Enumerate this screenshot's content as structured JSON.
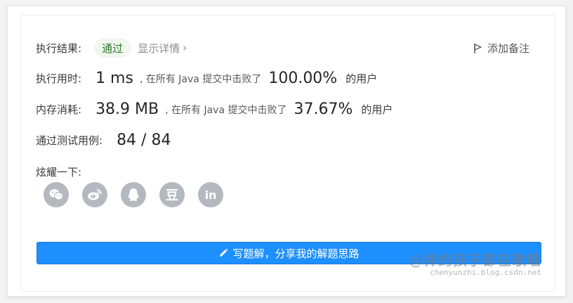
{
  "result": {
    "label": "执行结果:",
    "status": "通过",
    "detail_link": "显示详情",
    "note_button": "添加备注"
  },
  "runtime": {
    "label": "执行用时:",
    "value": "1 ms",
    "text": ", 在所有 Java 提交中击败了",
    "percent": "100.00%",
    "suffix": "的用户"
  },
  "memory": {
    "label": "内存消耗:",
    "value": "38.9 MB",
    "text": ", 在所有 Java 提交中击败了",
    "percent": "37.67%",
    "suffix": "的用户"
  },
  "tests": {
    "label": "通过测试用例:",
    "value": "84 / 84"
  },
  "share": {
    "label": "炫耀一下:",
    "icons": [
      "wechat-icon",
      "weibo-icon",
      "qq-icon",
      "douban-icon",
      "linkedin-icon"
    ],
    "douban_glyph": "豆",
    "linkedin_glyph": "in"
  },
  "write_button": "写题解，分享我的解题思路",
  "watermark": {
    "main": "@神的孩子都在歌唱",
    "sub": "chenyunzhi.blog.csdn.net"
  },
  "colors": {
    "accent": "#1e8fff",
    "pass_text": "#2e7d32",
    "pass_bg": "#f0f7ec",
    "icon_gray": "#b4b8bf"
  }
}
